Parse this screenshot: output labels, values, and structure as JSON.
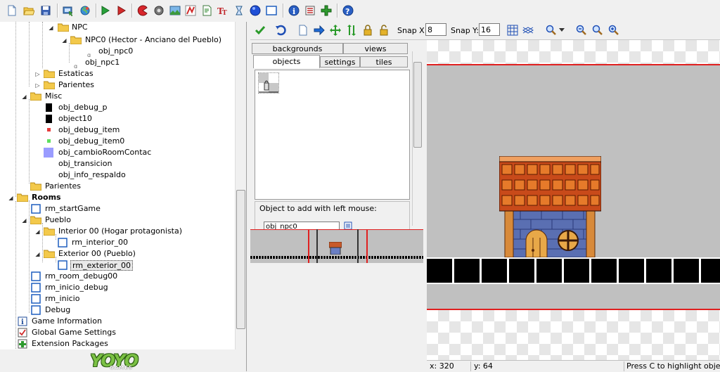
{
  "toolbar": {
    "icons": [
      "new-icon",
      "open-icon",
      "save-icon",
      "create-executable-icon",
      "publish-icon",
      "run-icon",
      "debug-icon",
      "sprite-icon",
      "sound-icon",
      "background-icon",
      "path-icon",
      "script-icon",
      "font-icon",
      "timeline-icon",
      "object-icon",
      "room-icon",
      "game-info-icon",
      "global-settings-icon",
      "extension-icon",
      "help-icon"
    ]
  },
  "tree": {
    "npc_folder": "NPC",
    "npc0_folder": "NPC0 (Hector - Anciano del Pueblo)",
    "obj_npc0": "obj_npc0",
    "obj_npc1": "obj_npc1",
    "estaticas": "Estaticas",
    "parientes1": "Parientes",
    "misc": "Misc",
    "obj_debug_p": "obj_debug_p",
    "object10": "object10",
    "obj_debug_item": "obj_debug_item",
    "obj_debug_item0": "obj_debug_item0",
    "obj_cambio": "obj_cambioRoomContac",
    "obj_transicion": "obj_transicion",
    "obj_info": "obj_info_respaldo",
    "parientes2": "Parientes",
    "rooms": "Rooms",
    "rm_startGame": "rm_startGame",
    "pueblo": "Pueblo",
    "interior_folder": "Interior 00 (Hogar protagonista)",
    "rm_interior": "rm_interior_00",
    "exterior_folder": "Exterior 00 (Pueblo)",
    "rm_exterior": "rm_exterior_00",
    "rm_room_debug": "rm_room_debug00",
    "rm_inicio_debug": "rm_inicio_debug",
    "rm_inicio": "rm_inicio",
    "debug": "Debug",
    "game_info": "Game Information",
    "global_settings": "Global Game Settings",
    "extension_packages": "Extension Packages"
  },
  "logo": {
    "main": "YOYO",
    "sub": "GAMES"
  },
  "room_toolbar": {
    "snap_x_label": "Snap X:",
    "snap_x_value": "8",
    "snap_y_label": "Snap Y:",
    "snap_y_value": "16"
  },
  "tabs": {
    "backgrounds": "backgrounds",
    "views": "views",
    "objects": "objects",
    "settings": "settings",
    "tiles": "tiles"
  },
  "object_select": {
    "label": "Object to add with left mouse:",
    "value": "obj_npc0"
  },
  "status": {
    "x": "x: 320",
    "y": "y: 64",
    "hint": "Press C to highlight objects"
  }
}
